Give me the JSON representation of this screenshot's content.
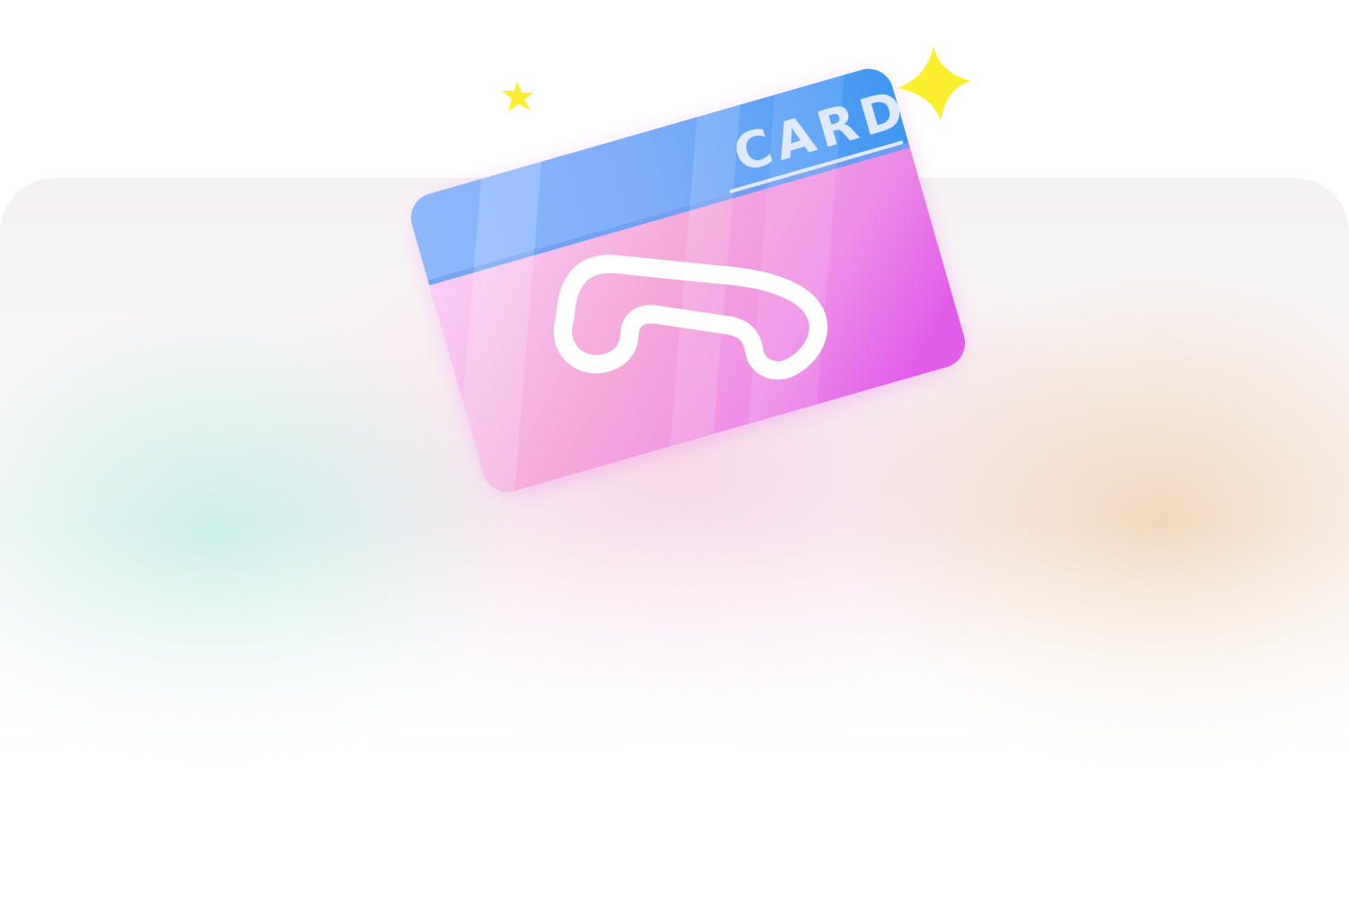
{
  "illustration": {
    "card_label": "CARD",
    "icon": "telephone-handset-icon",
    "decorations": [
      "sparkle-star-icon",
      "sparkle-star-icon"
    ]
  },
  "colors": {
    "card_band": "#5a9ef5",
    "card_body": "#ef8ee8",
    "card_body_accent": "#e05ae8",
    "card_label": "#dfeaff",
    "handset_outline": "#ffffff",
    "sparkle": "#fdee30",
    "glow_left": "#c4ece4",
    "glow_right": "#f0d4b8",
    "glow_center": "#f6cee2"
  }
}
